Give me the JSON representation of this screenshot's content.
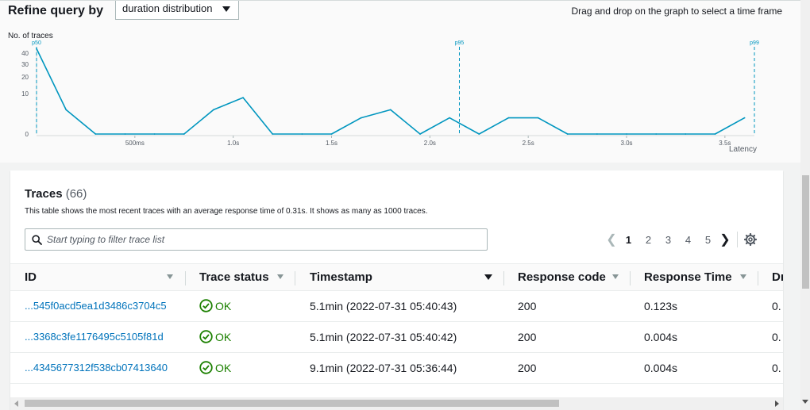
{
  "header": {
    "title": "Refine query by",
    "select_value": "duration distribution",
    "drag_hint": "Drag and drop on the graph to select a time frame"
  },
  "chart_data": {
    "type": "line",
    "ylabel": "No. of traces",
    "xlabel": "Latency",
    "y_ticks": [
      "0",
      "10",
      "20",
      "30",
      "40"
    ],
    "x_ticks": [
      "500ms",
      "1.0s",
      "1.5s",
      "2.0s",
      "2.5s",
      "3.0s",
      "3.5s"
    ],
    "markers": [
      {
        "name": "p50",
        "x": 0.0
      },
      {
        "name": "p95",
        "x": 2.15
      },
      {
        "name": "p99",
        "x": 3.65
      }
    ],
    "series": [
      {
        "x": [
          0,
          0.15,
          0.3,
          0.45,
          0.6,
          0.75,
          0.9,
          1.05,
          1.2,
          1.35,
          1.5,
          1.65,
          1.8,
          1.95,
          2.1,
          2.25,
          2.4,
          2.55,
          2.7,
          2.85,
          3.0,
          3.15,
          3.3,
          3.45,
          3.6
        ],
        "values": [
          44,
          6,
          0,
          0,
          0,
          0,
          6,
          9,
          0,
          0,
          0,
          4,
          6,
          0,
          4,
          0,
          4,
          4,
          0,
          0,
          0,
          0,
          0,
          0,
          4
        ]
      }
    ],
    "xlim": [
      0,
      3.65
    ],
    "ylim": [
      0,
      45
    ],
    "grid": false,
    "color": "#0096bf"
  },
  "traces": {
    "title": "Traces",
    "count": "(66)",
    "description": "This table shows the most recent traces with an average response time of 0.31s. It shows as many as 1000 traces.",
    "filter_placeholder": "Start typing to filter trace list",
    "pages": [
      "1",
      "2",
      "3",
      "4",
      "5"
    ],
    "columns": [
      {
        "label": "ID"
      },
      {
        "label": "Trace status"
      },
      {
        "label": "Timestamp"
      },
      {
        "label": "Response code"
      },
      {
        "label": "Response Time"
      },
      {
        "label": "Dı"
      }
    ],
    "rows": [
      {
        "id": "...545f0acd5ea1d3486c3704c5",
        "status": "OK",
        "timestamp": "5.1min (2022-07-31 05:40:43)",
        "code": "200",
        "time": "0.123s",
        "extra": "0."
      },
      {
        "id": "...3368c3fe1176495c5105f81d",
        "status": "OK",
        "timestamp": "5.1min (2022-07-31 05:40:42)",
        "code": "200",
        "time": "0.004s",
        "extra": "0."
      },
      {
        "id": "...4345677312f538cb07413640",
        "status": "OK",
        "timestamp": "9.1min (2022-07-31 05:36:44)",
        "code": "200",
        "time": "0.004s",
        "extra": "0."
      }
    ]
  }
}
